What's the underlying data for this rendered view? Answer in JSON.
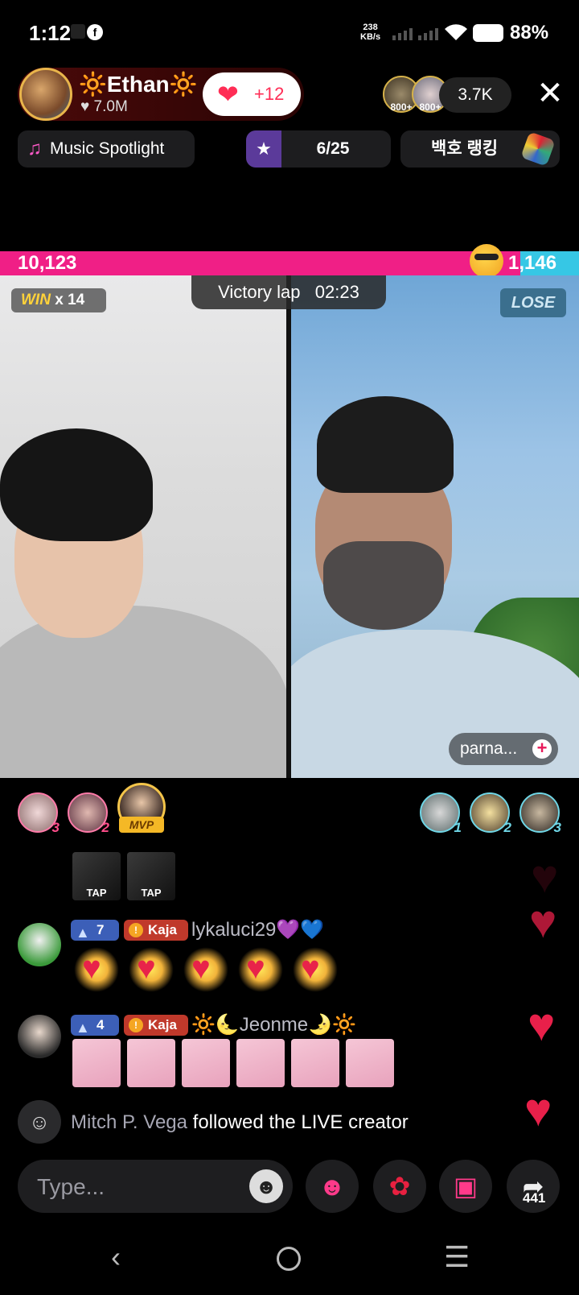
{
  "status_bar": {
    "time": "1:12",
    "net_speed": "238",
    "net_unit": "KB/s",
    "battery": "88%"
  },
  "host": {
    "name": "🔆Ethan🔆",
    "likes": "♥ 7.0M",
    "like_button_count": "+12"
  },
  "viewers": {
    "badge_1": "800+",
    "badge_2": "800+",
    "count": "3.7K"
  },
  "chips": {
    "music": "Music Spotlight",
    "rank": "6/25",
    "korean": "백호 랭킹"
  },
  "battle": {
    "score_left": "10,123",
    "score_right": "1,146",
    "win_label": "WIN",
    "win_count": "x 14",
    "status": "Victory lap   02:23",
    "lose_label": "LOSE",
    "opponent_name": "parna...",
    "left_share": 0.898
  },
  "gifters": {
    "left": [
      "3",
      "2"
    ],
    "mvp": "MVP",
    "right": [
      "1",
      "2",
      "3"
    ]
  },
  "tap_label": "TAP",
  "comments": [
    {
      "level": "7",
      "badge": "Kaja",
      "name": "lykaluci29💜💙"
    },
    {
      "level": "4",
      "badge": "Kaja",
      "name": "🔆🌜Jeonme🌛🔆"
    }
  ],
  "follow_event": {
    "who": "Mitch P. Vega",
    "text": " followed the LIVE creator"
  },
  "input": {
    "placeholder": "Type..."
  },
  "share_count": "441",
  "colors": {
    "battle_left": "#f01f86",
    "battle_right": "#36c7e5",
    "heart": "#e8204a"
  }
}
